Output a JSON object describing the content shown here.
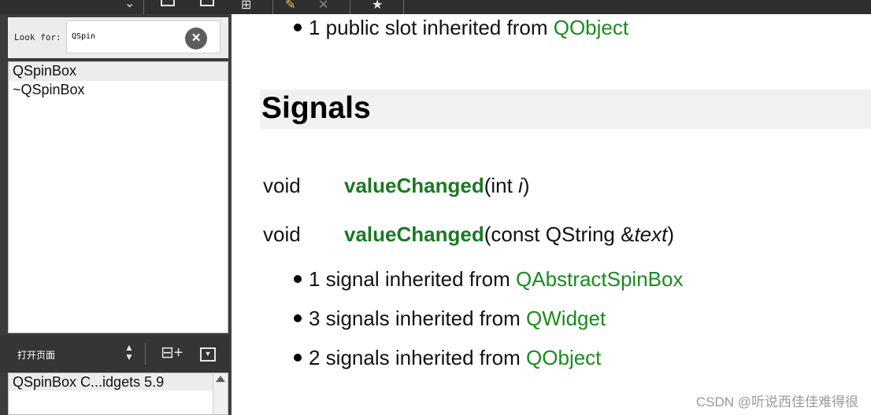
{
  "index_panel": {
    "look_for_label": "Look for:",
    "search_value": "QSpin",
    "results": [
      "QSpinBox",
      "~QSpinBox"
    ]
  },
  "open_pages": {
    "label": "打开页面",
    "pages": [
      "QSpinBox C...idgets 5.9"
    ]
  },
  "content": {
    "top_bullet": {
      "text": "1 public slot inherited from ",
      "link": "QObject"
    },
    "section_title": "Signals",
    "signals": [
      {
        "type": "void",
        "name": "valueChanged",
        "open": "(int ",
        "param": "i",
        "close": ")"
      },
      {
        "type": "void",
        "name": "valueChanged",
        "open": "(const QString &",
        "param": "text",
        "close": ")"
      }
    ],
    "inherited": [
      {
        "text": "1 signal inherited from ",
        "link": "QAbstractSpinBox"
      },
      {
        "text": "3 signals inherited from ",
        "link": "QWidget"
      },
      {
        "text": "2 signals inherited from ",
        "link": "QObject"
      }
    ]
  },
  "watermark": "CSDN @听说西佳佳难得很",
  "colors": {
    "link": "#1a8a1f",
    "signal_name": "#1a7a22",
    "sidebar_bg": "#3c3c3c"
  }
}
